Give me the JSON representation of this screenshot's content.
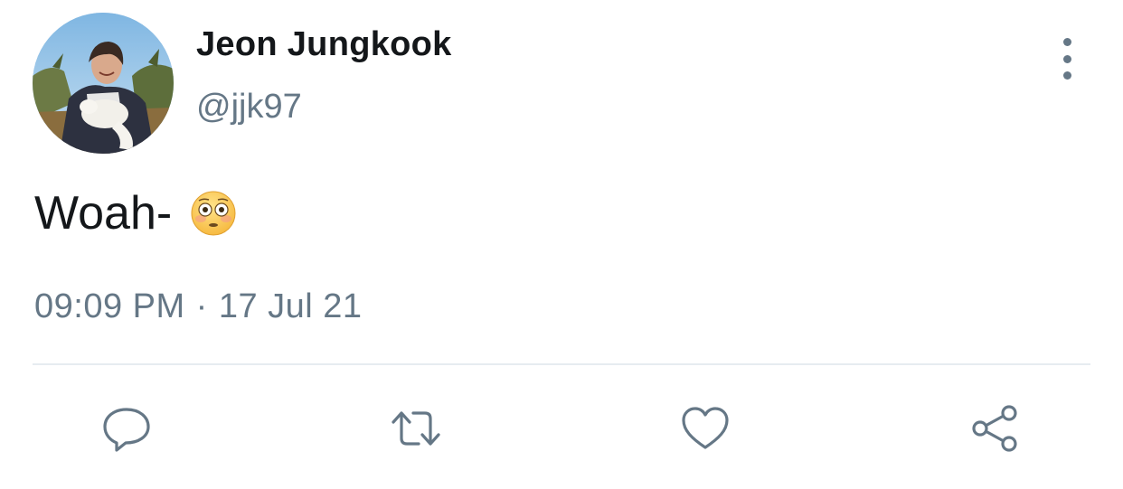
{
  "tweet": {
    "author": {
      "display_name": "Jeon Jungkook",
      "handle": "@jjk97"
    },
    "text": "Woah-",
    "emoji": "flushed-face",
    "time": "09:09 PM",
    "separator": "·",
    "date": "17 Jul 21"
  },
  "icons": {
    "more": "more-vertical-icon",
    "reply": "reply-icon",
    "retweet": "retweet-icon",
    "like": "heart-icon",
    "share": "share-icon"
  },
  "colors": {
    "text": "#14171a",
    "secondary": "#657786",
    "divider": "#e6ecf0"
  }
}
